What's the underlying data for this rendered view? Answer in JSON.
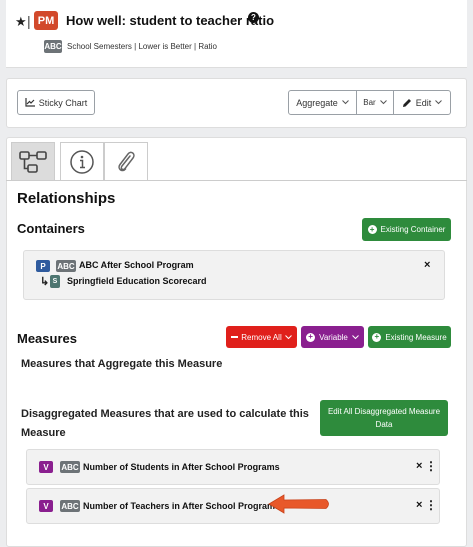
{
  "header": {
    "star_icon": "star-icon",
    "divider": "|",
    "badge": "PM",
    "title": "How well: student to teacher ratio",
    "help_icon": "?",
    "abc_badge": "ABC",
    "subtitle": "School Semesters | Lower is Better | Ratio",
    "badge_color": "#d2492b"
  },
  "toolbar": {
    "sticky_chart": "Sticky Chart",
    "aggregate": "Aggregate",
    "bar": "Bar",
    "edit": "Edit"
  },
  "tabs": [
    {
      "icon": "relationships-icon",
      "active": true
    },
    {
      "icon": "info-icon",
      "active": false
    },
    {
      "icon": "paperclip-icon",
      "active": false
    }
  ],
  "relationships": {
    "heading": "Relationships",
    "containers": {
      "heading": "Containers",
      "existing_button": "Existing Container",
      "item": {
        "type_badge": "P",
        "abc_badge": "ABC",
        "name": "ABC After School Program",
        "child_arrow": "↳",
        "child_badge": "S",
        "child_name": "Springfield Education Scorecard",
        "close": "×"
      }
    },
    "measures": {
      "heading": "Measures",
      "remove_all": "Remove All",
      "variable": "Variable",
      "existing_measure": "Existing Measure",
      "aggregate_heading": "Measures that Aggregate this Measure",
      "disaggregated_heading": "Disaggregated Measures that are used to calculate this Measure",
      "edit_all_button": "Edit All Disaggregated Measure Data",
      "items": [
        {
          "type_badge": "V",
          "abc_badge": "ABC",
          "label": "Number of Students in After School Programs",
          "close": "×",
          "menu": "⋮"
        },
        {
          "type_badge": "V",
          "abc_badge": "ABC",
          "label": "Number of Teachers in After School Programs",
          "close": "×",
          "menu": "⋮"
        }
      ]
    }
  },
  "colors": {
    "green": "#2e8b3c",
    "red": "#e0201b",
    "purple": "#8a1f8f",
    "annotation_arrow": "#e8582a"
  }
}
